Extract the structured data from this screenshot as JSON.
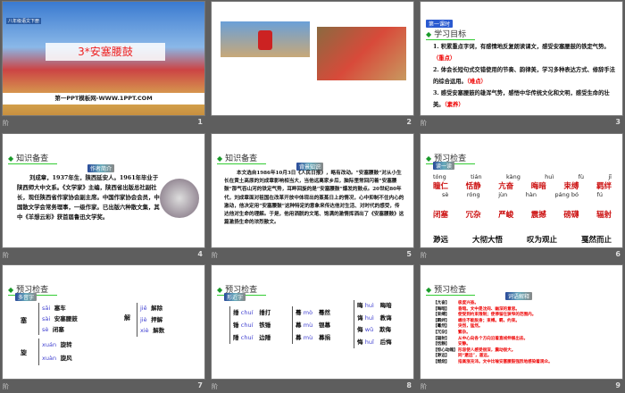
{
  "slides": [
    {
      "number": "1",
      "book_label": "八年级语文下册",
      "title": "3*安塞腰鼓",
      "site": "第一PPT模板网-WWW.1PPT.COM"
    },
    {
      "number": "2"
    },
    {
      "number": "3",
      "badge": "第一课时",
      "heading": "学习目标",
      "items": [
        {
          "text": "1. 积累重点字词，有感情地反复朗读课文，感受安塞腰鼓的铁定气势。",
          "tag": "（重点）"
        },
        {
          "text": "2. 体会长短句式交错使用的节奏、韵律美，学习多种表达方式、修辞手法的综合运用。",
          "tag": "（难点）"
        },
        {
          "text": "3. 感受安塞腰鼓的雄浑气势，感悟中华传统文化和文明，感受生命的壮美。",
          "tag": "（素养）"
        }
      ]
    },
    {
      "number": "4",
      "heading": "知识备查",
      "badge": "作者简介",
      "text": "刘成章，1937年生，陕西延安人。1961年毕业于陕西师大中文系。《文学家》主编，陕西省出版总社副社长，现任陕西省作家协会副主席。中国作家协会会员，中国散文学会常务理事，一级作家。已出版六种散文集，其中《羊想云彩》获首届鲁迅文学奖。"
    },
    {
      "number": "5",
      "heading": "知识备查",
      "badge": "背景知识",
      "text": "本文选自1986年10月3日《人民日报》，略有改动。“安塞腰鼓”对从小生长在黄土高原的刘成章影响相当大，当他远离家乡后，脑际里常回闪着“安塞腰鼓”那气吞山河的铁定气势，耳畔回旋的是“安塞腰鼓”爆发的鼓点。20世纪80年代，刘成章面对祖国在改革开放中体现出的蒸蒸日上的情况，心中抑制不住内心的激动，他决定用“安塞腰鼓”这种特定的意象来传达他对生活、对时代的感受，传达他对生命的理解。于是，他用洒脱的文笔、饱满的激情挥洒出了《安塞腰鼓》这篇激扬生命的浓烈散文。"
    },
    {
      "number": "6",
      "heading": "预习检查",
      "badge": "读一读",
      "row1_pinyin": [
        "tóng",
        "tián",
        "kàng",
        "huì",
        "fù",
        "jī"
      ],
      "row1_words": [
        "瞳仁",
        "恬静",
        "亢奋",
        "晦暗",
        "束缚",
        "羁绊"
      ],
      "row2_pinyin": [
        "sè",
        "róng",
        "jùn",
        "hàn",
        "páng bó",
        "fú"
      ],
      "row2_words": [
        "闭塞",
        "冗杂",
        "严峻",
        "震撼",
        "磅礴",
        "辐射"
      ],
      "row3_words": [
        "渺远",
        "大彻大悟",
        "叹为观止",
        "戛然而止"
      ]
    },
    {
      "number": "7",
      "heading": "预习检查",
      "badge": "多音字",
      "groups": [
        {
          "char": "塞",
          "items": [
            {
              "py": "sāi",
              "word": "塞车"
            },
            {
              "py": "sài",
              "word": "安塞腰鼓"
            },
            {
              "py": "sè",
              "word": "闭塞"
            }
          ]
        },
        {
          "char": "旋",
          "items": [
            {
              "py": "xuán",
              "word": "旋转"
            },
            {
              "py": "xuàn",
              "word": "旋风"
            }
          ]
        },
        {
          "char": "解",
          "items": [
            {
              "py": "jiě",
              "word": "解除"
            },
            {
              "py": "jiè",
              "word": "押解"
            },
            {
              "py": "xiè",
              "word": "解数"
            }
          ]
        }
      ]
    },
    {
      "number": "8",
      "heading": "预习检查",
      "badge": "形近字",
      "groups": [
        [
          {
            "ch": "捶",
            "py": "chuí",
            "word": "捶打"
          },
          {
            "ch": "锤",
            "py": "chuí",
            "word": "铁锤"
          },
          {
            "ch": "陲",
            "py": "chuí",
            "word": "边陲"
          }
        ],
        [
          {
            "ch": "蓦",
            "py": "mò",
            "word": "蓦然"
          },
          {
            "ch": "幕",
            "py": "mù",
            "word": "银幕"
          },
          {
            "ch": "募",
            "py": "mù",
            "word": "募捐"
          }
        ],
        [
          {
            "ch": "晦",
            "py": "huì",
            "word": "晦暗"
          },
          {
            "ch": "诲",
            "py": "huì",
            "word": "教诲"
          },
          {
            "ch": "侮",
            "py": "wǔ",
            "word": "欺侮"
          },
          {
            "ch": "悔",
            "py": "huǐ",
            "word": "后悔"
          }
        ]
      ]
    },
    {
      "number": "9",
      "heading": "预习检查",
      "badge": "词语解释",
      "defs": [
        {
          "term": "【亢奋】",
          "def": "极度兴奋。"
        },
        {
          "term": "【晦暗】",
          "def": "昏暗。文中是沈闷、幽深的意思。"
        },
        {
          "term": "【束缚】",
          "def": "使受到约束限制；使停留在狭窄的范围内。"
        },
        {
          "term": "【羁绊】",
          "def": "缠住不能脱身；束缚。羁，约束。"
        },
        {
          "term": "【蓦然】",
          "def": "突然，猛然。"
        },
        {
          "term": "【冗杂】",
          "def": "繁杂。"
        },
        {
          "term": "【辐射】",
          "def": "从中心向各个方向沿着直线伸展出去。"
        },
        {
          "term": "【恬静】",
          "def": "安静。"
        },
        {
          "term": "【惊心动魄】",
          "def": "形容使人感受很深，震动很大。"
        },
        {
          "term": "【渺远】",
          "def": "同“邈远”，遥远。"
        },
        {
          "term": "【燃烧】",
          "def": "指高涨充沛。文中比喻安塞腰鼓强烈地感染着观众。"
        }
      ]
    }
  ]
}
